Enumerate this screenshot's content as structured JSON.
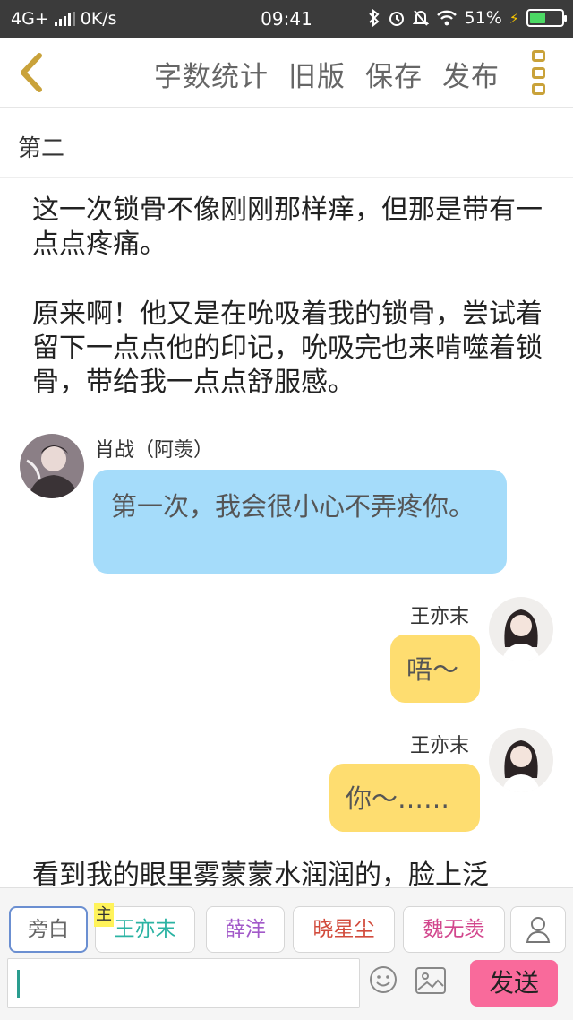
{
  "status_bar": {
    "network": "4G+",
    "speed": "0K/s",
    "time": "09:41",
    "battery": "51%",
    "battery_level": 0.51,
    "icons": [
      "signal-icon",
      "bluetooth-icon",
      "alarm-icon",
      "mute-icon",
      "wifi-icon",
      "battery-icon"
    ]
  },
  "toolbar": {
    "back_icon": "chevron-left-icon",
    "word_count": "字数统计",
    "old_version": "旧版",
    "save": "保存",
    "publish": "发布",
    "more_icon": "more-icon",
    "accent_color": "#c9a23a"
  },
  "chapter": {
    "title": "第二"
  },
  "content": {
    "para1": "这一次锁骨不像刚刚那样痒，但那是带有一点点疼痛。",
    "para2": "原来啊！他又是在吮吸着我的锁骨，尝试着留下一点点他的印记，吮吸完也来啃噬着锁骨，带给我一点点舒服感。",
    "para3": "看到我的眼里雾蒙蒙水润润的，脸上泛"
  },
  "messages": [
    {
      "speaker": "肖战（阿羡）",
      "text": "第一次，我会很小心不弄疼你。",
      "side": "left",
      "color": "#a5dcfa"
    },
    {
      "speaker": "王亦末",
      "text": "唔～",
      "side": "right",
      "color": "#fedd70"
    },
    {
      "speaker": "王亦末",
      "text": "你～……",
      "side": "right",
      "color": "#fedd70"
    }
  ],
  "roles": {
    "narration": "旁白",
    "host_badge": "主",
    "items": [
      {
        "label": "王亦末",
        "color": "#2bb3a3"
      },
      {
        "label": "薛洋",
        "color": "#a259c9"
      },
      {
        "label": "晓星尘",
        "color": "#d24b3c"
      },
      {
        "label": "魏无羡",
        "color": "#d2468d"
      }
    ],
    "add_role_icon": "person-icon"
  },
  "composer": {
    "input_value": "",
    "emoji_icon": "emoji-icon",
    "image_icon": "image-icon",
    "send_label": "发送",
    "send_color": "#f96a9b"
  }
}
